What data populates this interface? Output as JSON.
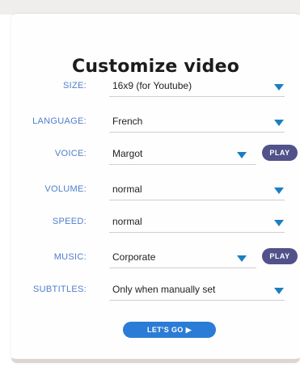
{
  "title": "Customize video",
  "fields": {
    "size": {
      "label": "SIZE:",
      "value": "16x9 (for Youtube)"
    },
    "language": {
      "label": "LANGUAGE:",
      "value": "French"
    },
    "voice": {
      "label": "VOICE:",
      "value": "Margot",
      "play_label": "PLAY"
    },
    "volume": {
      "label": "VOLUME:",
      "value": "normal"
    },
    "speed": {
      "label": "SPEED:",
      "value": "normal"
    },
    "music": {
      "label": "MUSIC:",
      "value": "Corporate",
      "play_label": "PLAY"
    },
    "subtitles": {
      "label": "SUBTITLES:",
      "value": "Only when manually set"
    }
  },
  "submit_label": "LET'S GO ▶",
  "icons": {
    "dropdown": "chevron-down-icon",
    "play": "play-icon"
  },
  "colors": {
    "label": "#4f7ecb",
    "caret": "#1a7fc1",
    "play_button": "#51528a",
    "go_button": "#2b7cd6",
    "card_bottom": "#dcd5d0"
  }
}
